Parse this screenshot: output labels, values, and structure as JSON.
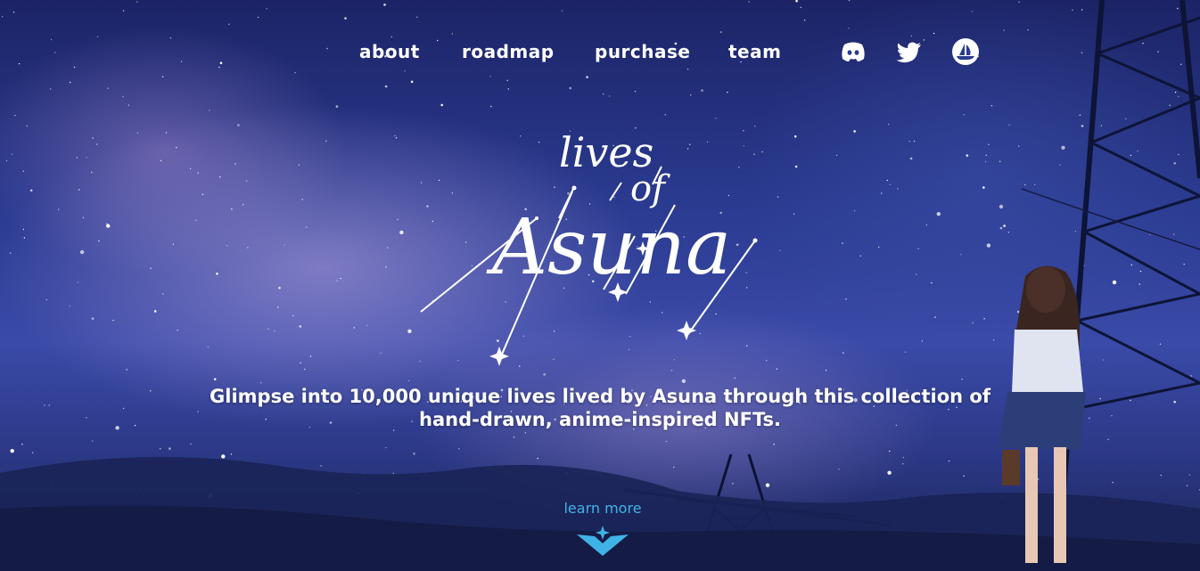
{
  "nav": {
    "links": [
      {
        "label": "about"
      },
      {
        "label": "roadmap"
      },
      {
        "label": "purchase"
      },
      {
        "label": "team"
      }
    ],
    "social": [
      {
        "icon": "discord-icon"
      },
      {
        "icon": "twitter-icon"
      },
      {
        "icon": "opensea-icon"
      }
    ]
  },
  "logo": {
    "line1": "lives",
    "line2": "of",
    "line3": "Asuna"
  },
  "hero": {
    "tagline_line1": "Glimpse into 10,000 unique lives lived by Asuna through this collection of",
    "tagline_line2": "hand-drawn, anime-inspired NFTs."
  },
  "cta": {
    "learn_more": "learn more"
  },
  "colors": {
    "accent": "#3fb3e6",
    "text": "#ffffff",
    "sky_top": "#1c2466",
    "sky_mid": "#3a4aa8"
  }
}
